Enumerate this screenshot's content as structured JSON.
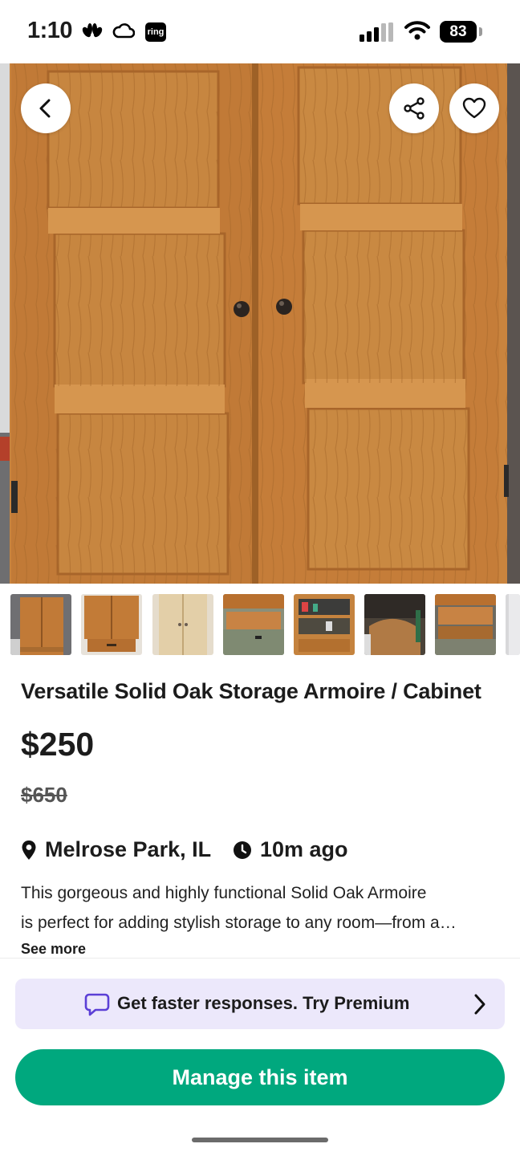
{
  "status_bar": {
    "time": "1:10",
    "ring_label": "ring",
    "battery": "83"
  },
  "listing": {
    "title": "Versatile Solid Oak Storage Armoire / Cabinet",
    "price": "$250",
    "original_price": "$650",
    "location": "Melrose Park, IL",
    "posted": "10m ago",
    "description_line1": "This gorgeous and highly functional Solid Oak Armoire",
    "description_line2": "is perfect for adding stylish storage to any room—from a…",
    "see_more": "See more",
    "photo_count": 8
  },
  "premium_banner": {
    "text": "Get faster responses.  Try Premium"
  },
  "actions": {
    "manage_label": "Manage this item"
  },
  "icons": {
    "back": "chevron-left-icon",
    "share": "share-icon",
    "favorite": "heart-icon",
    "location": "location-pin-icon",
    "time": "clock-icon",
    "chat": "chat-bubble-icon",
    "chevron": "chevron-right-icon"
  },
  "colors": {
    "accent": "#00a87e",
    "premium_bg": "#ece8fb",
    "premium_icon": "#5b3fd6"
  }
}
